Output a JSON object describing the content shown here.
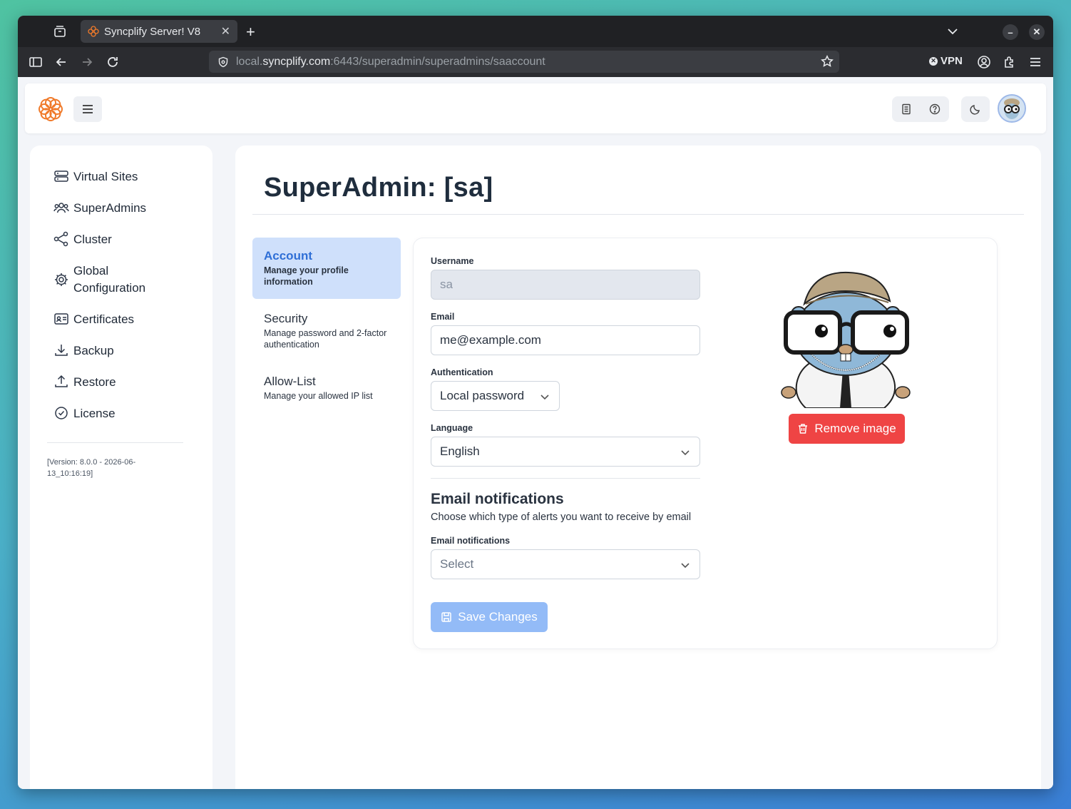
{
  "browser": {
    "tab_title": "Syncplify Server! V8",
    "url_prefix": "local.",
    "url_host": "syncplify.com",
    "url_rest": ":6443/superadmin/superadmins/saaccount",
    "vpn_label": "VPN"
  },
  "sidebar": {
    "items": [
      {
        "label": "Virtual Sites",
        "icon": "server-icon"
      },
      {
        "label": "SuperAdmins",
        "icon": "users-icon"
      },
      {
        "label": "Cluster",
        "icon": "share-icon"
      },
      {
        "label": "Global Configuration",
        "icon": "gear-icon"
      },
      {
        "label": "Certificates",
        "icon": "id-card-icon"
      },
      {
        "label": "Backup",
        "icon": "download-icon"
      },
      {
        "label": "Restore",
        "icon": "upload-icon"
      },
      {
        "label": "License",
        "icon": "badge-check-icon"
      }
    ],
    "version": "[Version: 8.0.0 - 2026-06-13_10:16:19]"
  },
  "main": {
    "title": "SuperAdmin: [sa]",
    "subnav": [
      {
        "title": "Account",
        "desc": "Manage your profile information"
      },
      {
        "title": "Security",
        "desc": "Manage password and 2-factor authentication"
      },
      {
        "title": "Allow-List",
        "desc": "Manage your allowed IP list"
      }
    ]
  },
  "form": {
    "username_label": "Username",
    "username_value": "sa",
    "email_label": "Email",
    "email_value": "me@example.com",
    "auth_label": "Authentication",
    "auth_value": "Local password",
    "language_label": "Language",
    "language_value": "English",
    "notif_title": "Email notifications",
    "notif_subtitle": "Choose which type of alerts you want to receive by email",
    "notif_label": "Email notifications",
    "notif_placeholder": "Select",
    "save_label": "Save Changes",
    "remove_image_label": "Remove image"
  },
  "colors": {
    "accent": "#2f6fd6",
    "danger": "#ef4444",
    "brand": "#f07a2a"
  }
}
